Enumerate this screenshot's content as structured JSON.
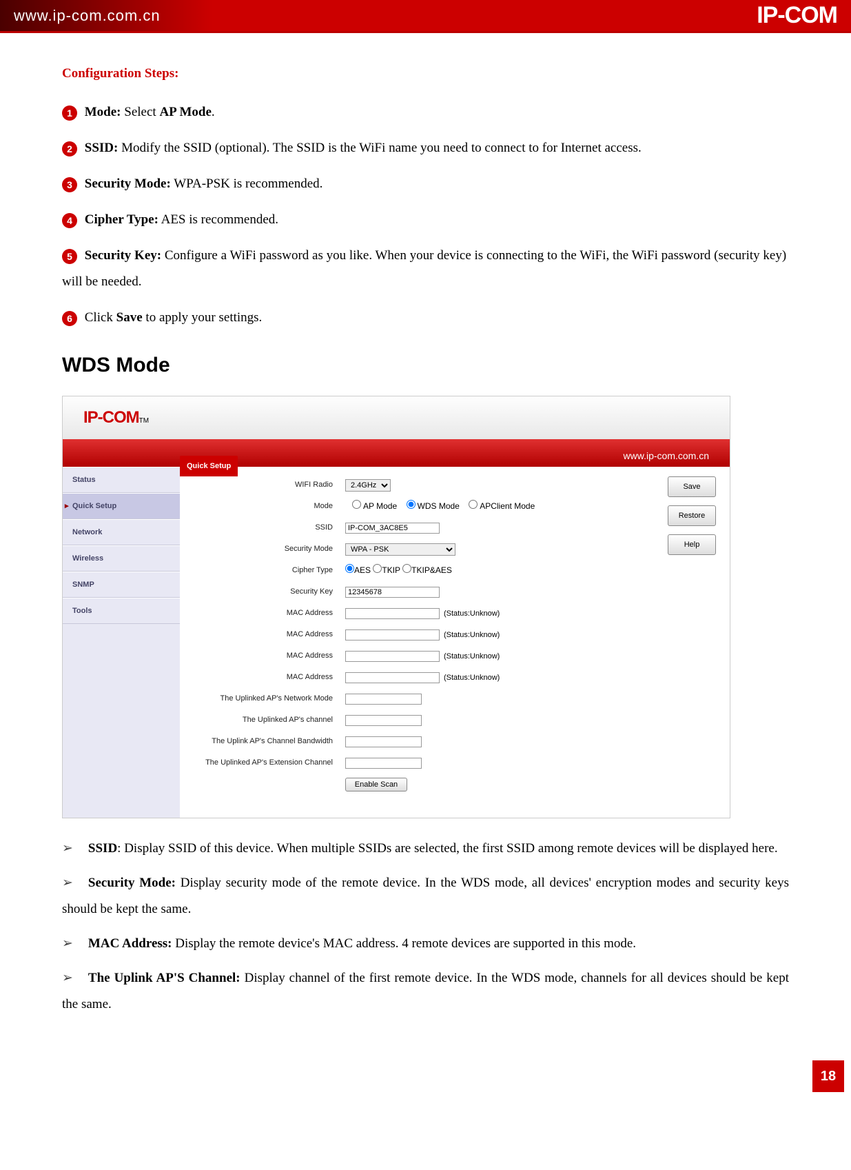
{
  "header": {
    "url": "www.ip-com.com.cn",
    "logo": "IP-COM"
  },
  "section_title": "Configuration Steps:",
  "steps": [
    {
      "num": "1",
      "label": "Mode:",
      "text_before": " Select ",
      "bold_mid": "AP Mode",
      "text_after": "."
    },
    {
      "num": "2",
      "label": "SSID:",
      "text_before": " Modify the SSID (optional). The SSID is the WiFi name you need to connect to for Internet access.",
      "bold_mid": "",
      "text_after": ""
    },
    {
      "num": "3",
      "label": "Security Mode:",
      "text_before": " WPA-PSK is recommended.",
      "bold_mid": "",
      "text_after": ""
    },
    {
      "num": "4",
      "label": "Cipher Type:",
      "text_before": " AES is recommended.",
      "bold_mid": "",
      "text_after": ""
    },
    {
      "num": "5",
      "label": "Security Key:",
      "text_before": " Configure a WiFi password as you like. When your device is connecting to the WiFi, the WiFi password (security key) will be needed.",
      "bold_mid": "",
      "text_after": ""
    },
    {
      "num": "6",
      "label": "",
      "text_before": "Click ",
      "bold_mid": "Save",
      "text_after": " to apply your settings."
    }
  ],
  "wds_heading": "WDS Mode",
  "ui": {
    "logo": "IP-COM",
    "logo_tm": "TM",
    "url": "www.ip-com.com.cn",
    "quick_tab": "Quick Setup",
    "sidebar": [
      "Status",
      "Quick Setup",
      "Network",
      "Wireless",
      "SNMP",
      "Tools"
    ],
    "buttons": {
      "save": "Save",
      "restore": "Restore",
      "help": "Help"
    },
    "rows": {
      "wifi_radio_lbl": "WIFI Radio",
      "wifi_radio_val": "2.4GHz",
      "mode_lbl": "Mode",
      "mode_opts": [
        "AP Mode",
        "WDS Mode",
        "APClient Mode"
      ],
      "ssid_lbl": "SSID",
      "ssid_val": "IP-COM_3AC8E5",
      "secmode_lbl": "Security Mode",
      "secmode_val": "WPA - PSK",
      "cipher_lbl": "Cipher Type",
      "cipher_opts": [
        "AES",
        "TKIP",
        "TKIP&AES"
      ],
      "seckey_lbl": "Security Key",
      "seckey_val": "12345678",
      "mac_lbl": "MAC Address",
      "mac_status": "(Status:Unknow)",
      "uplink_net_lbl": "The Uplinked AP's Network Mode",
      "uplink_ch_lbl": "The Uplinked AP's channel",
      "uplink_bw_lbl": "The Uplink AP's Channel Bandwidth",
      "uplink_ext_lbl": "The Uplinked AP's Extension Channel",
      "enable_scan": "Enable Scan"
    }
  },
  "bullets": [
    {
      "label": "SSID",
      "sep": ": ",
      "text": "Display SSID of this device. When multiple SSIDs are selected, the first SSID among remote devices will be displayed here."
    },
    {
      "label": "Security Mode:",
      "sep": " ",
      "text": "Display security mode of the remote device. In the WDS mode, all devices' encryption modes and security keys should be kept the same."
    },
    {
      "label": "MAC Address:",
      "sep": " ",
      "text": "Display the remote device's MAC address. 4 remote devices are supported in this mode."
    },
    {
      "label": "The Uplink AP'S Channel:",
      "sep": " ",
      "text": "Display channel of the first remote device. In the WDS mode, channels for all devices should be kept the same."
    }
  ],
  "page_number": "18"
}
